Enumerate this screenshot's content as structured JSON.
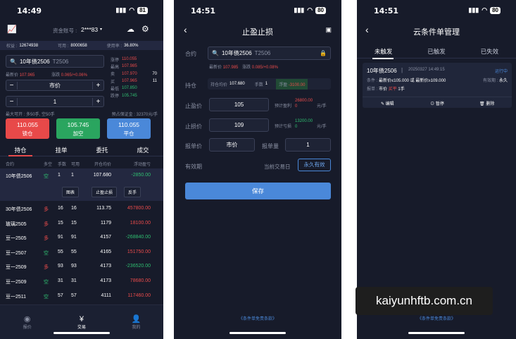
{
  "screen1": {
    "time": "14:49",
    "battery": "81",
    "account_label": "资金账号 :",
    "account_value": "2***83",
    "balance": {
      "equity_label": "权益 :",
      "equity": "12674938",
      "avail_label": "可用 :",
      "avail": "8000658",
      "usage_label": "使用率 :",
      "usage": "36.80%"
    },
    "contract": "10年债2506",
    "contract_code": "T2506",
    "latest_label": "最新价",
    "latest": "107.965",
    "change_label": "涨跌",
    "change": "0.065/+0.06%",
    "quote_rows": [
      {
        "l": "涨停",
        "v": "110.055",
        "c": "red"
      },
      {
        "l": "最高",
        "v": "107.985",
        "c": "red"
      },
      {
        "l": "卖",
        "v": "107.970",
        "n": "70",
        "c": "red"
      },
      {
        "l": "买",
        "v": "107.965",
        "n": "11",
        "c": "red"
      },
      {
        "l": "最低",
        "v": "107.850",
        "c": "green"
      },
      {
        "l": "跌停",
        "v": "105.745",
        "c": "green"
      }
    ],
    "price_type": "市价",
    "qty": "1",
    "minus": "−",
    "plus": "+",
    "max_open": "最大可开 : 多50手, 空50手",
    "margin": "预占保证金 : 32370元/手",
    "btn_buy": {
      "price": "110.055",
      "label": "锁仓"
    },
    "btn_sell": {
      "price": "105.745",
      "label": "加空"
    },
    "btn_close": {
      "price": "110.055",
      "label": "平仓"
    },
    "tabs": [
      "持仓",
      "挂单",
      "委托",
      "成交"
    ],
    "headers": [
      "合约",
      "多空",
      "手数",
      "可用",
      "开仓均价",
      "浮动盈亏"
    ],
    "first_row": {
      "name": "10年债2506",
      "dir": "空",
      "qty": "1",
      "avail": "1",
      "avg": "107.680",
      "pnl": "-2850.00",
      "dc": "green",
      "pc": "green"
    },
    "actions": [
      "图表",
      "止盈止损",
      "反手"
    ],
    "rows": [
      {
        "name": "30年债2506",
        "dir": "多",
        "qty": "16",
        "avail": "16",
        "avg": "113.75",
        "pnl": "457800.00",
        "dc": "red",
        "pc": "red"
      },
      {
        "name": "玻璃2505",
        "dir": "多",
        "qty": "15",
        "avail": "15",
        "avg": "1179",
        "pnl": "18100.00",
        "dc": "red",
        "pc": "red"
      },
      {
        "name": "豆一2505",
        "dir": "多",
        "qty": "91",
        "avail": "91",
        "avg": "4157",
        "pnl": "-268840.00",
        "dc": "red",
        "pc": "green"
      },
      {
        "name": "豆一2507",
        "dir": "空",
        "qty": "55",
        "avail": "55",
        "avg": "4165",
        "pnl": "151750.00",
        "dc": "green",
        "pc": "red"
      },
      {
        "name": "豆一2509",
        "dir": "多",
        "qty": "93",
        "avail": "93",
        "avg": "4173",
        "pnl": "-236520.00",
        "dc": "red",
        "pc": "green"
      },
      {
        "name": "豆一2509",
        "dir": "空",
        "qty": "31",
        "avail": "31",
        "avg": "4173",
        "pnl": "78680.00",
        "dc": "green",
        "pc": "red"
      },
      {
        "name": "豆一2511",
        "dir": "空",
        "qty": "57",
        "avail": "57",
        "avg": "4111",
        "pnl": "117460.00",
        "dc": "green",
        "pc": "red"
      }
    ],
    "bottom_nav": [
      "报价",
      "交易",
      "我的"
    ]
  },
  "screen2": {
    "time": "14:51",
    "battery": "80",
    "title": "止盈止损",
    "contract_label": "合约",
    "contract": "10年债2506",
    "contract_code": "T2506",
    "latest_label": "最新价",
    "latest": "107.985",
    "change_label": "涨跌",
    "change": "0.085/+0.08%",
    "position_label": "持仓",
    "avg_label": "持仓均价",
    "avg": "107.680",
    "qty_label": "手数",
    "qty": "1",
    "float_label": "浮盈",
    "float": "-3100.00",
    "tp_label": "止盈价",
    "tp_value": "105",
    "tp_est_label": "预计盈利",
    "tp_est": "26800.000",
    "tp_unit": "元/手",
    "sl_label": "止损价",
    "sl_value": "109",
    "sl_est_label": "预计亏损",
    "sl_est": "13200.000",
    "sl_unit": "元/手",
    "order_price_label": "报单价",
    "order_price": "市价",
    "order_qty_label": "报单量",
    "order_qty": "1",
    "validity_label": "有效期",
    "validity_opt1": "当前交易日",
    "validity_opt2": "永久有效",
    "save": "保存",
    "terms": "《条件单免责条款》"
  },
  "screen3": {
    "time": "14:51",
    "battery": "80",
    "title": "云条件单管理",
    "tabs": [
      "未触发",
      "已触发",
      "已失效"
    ],
    "card": {
      "contract": "10年债2506",
      "sep": "|",
      "datetime": "20250327 14:49:15",
      "status": "运行中",
      "cond_label": "条件 :",
      "cond": "最新价≤105.000 或 最新价≥109.000",
      "valid_label": "有效期 :",
      "valid": "永久",
      "order_label": "报单 :",
      "order_type": "市价",
      "order_side": "买平",
      "order_qty": "1手",
      "actions": [
        "编辑",
        "暂停",
        "删除"
      ]
    },
    "terms": "《条件单免责条款》"
  },
  "watermark": "kaiyunhftb.com.cn"
}
